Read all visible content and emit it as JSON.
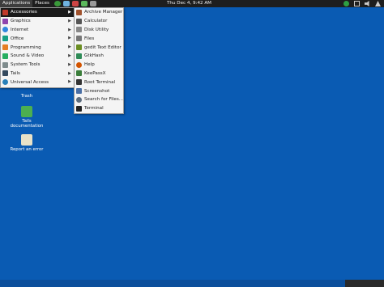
{
  "topbar": {
    "applications": "Applications",
    "places": "Places",
    "clock": "Thu Dec  4,  9:42 AM"
  },
  "categories": [
    {
      "label": "Accessories",
      "color": "#c0392b"
    },
    {
      "label": "Graphics",
      "color": "#8e44ad"
    },
    {
      "label": "Internet",
      "color": "#2e86de"
    },
    {
      "label": "Office",
      "color": "#16a085"
    },
    {
      "label": "Programming",
      "color": "#e67e22"
    },
    {
      "label": "Sound & Video",
      "color": "#27ae60"
    },
    {
      "label": "System Tools",
      "color": "#7f8c8d"
    },
    {
      "label": "Tails",
      "color": "#34495e"
    },
    {
      "label": "Universal Access",
      "color": "#2980b9"
    }
  ],
  "accessories": [
    {
      "label": "Archive Manager",
      "color": "#a0522d"
    },
    {
      "label": "Calculator",
      "color": "#555555"
    },
    {
      "label": "Disk Utility",
      "color": "#888888"
    },
    {
      "label": "Files",
      "color": "#777777"
    },
    {
      "label": "gedit Text Editor",
      "color": "#6b8e23"
    },
    {
      "label": "GtkHash",
      "color": "#2e8b57"
    },
    {
      "label": "Help",
      "color": "#d35400"
    },
    {
      "label": "KeePassX",
      "color": "#3a7d3a"
    },
    {
      "label": "Root Terminal",
      "color": "#333333"
    },
    {
      "label": "Screenshot",
      "color": "#4a6fa5"
    },
    {
      "label": "Search for Files...",
      "color": "#5d6d7e"
    },
    {
      "label": "Terminal",
      "color": "#222222"
    }
  ],
  "desktop": {
    "trash": "Trash",
    "tails_doc": "Tails documentation",
    "report": "Report an error"
  }
}
